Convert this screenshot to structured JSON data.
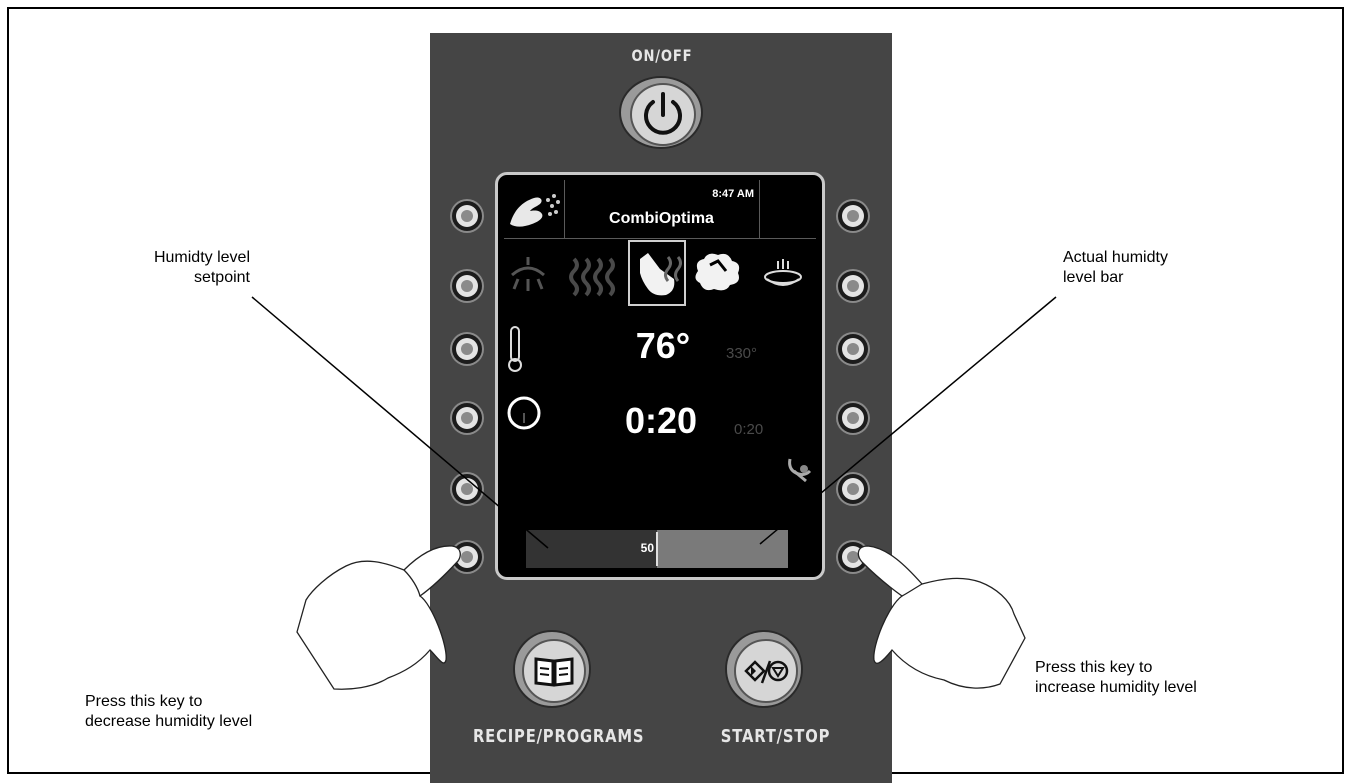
{
  "panel": {
    "on_off_label": "ON/OFF",
    "recipe_label": "RECIPE/PROGRAMS",
    "start_stop_label": "START/STOP"
  },
  "screen": {
    "time": "8:47 AM",
    "title": "CombiOptima",
    "temperature_actual": "76°",
    "temperature_set": "330°",
    "timer_actual": "0:20",
    "timer_set": "0:20",
    "humidity_setpoint": "50",
    "humidity_level": 0.5
  },
  "callouts": {
    "setpoint_line1": "Humidty level",
    "setpoint_line2": "setpoint",
    "bar_line1": "Actual humidty",
    "bar_line2": "level bar",
    "decrease_line1": "Press this key to",
    "decrease_line2": "decrease humidity level",
    "increase_line1": "Press this key to",
    "increase_line2": "increase humidity level"
  },
  "icons": [
    "power-icon",
    "hand-spray-icon",
    "shower-icon",
    "steam-waves-icon",
    "convection-fan-icon",
    "combi-steam-icon",
    "bowl-icon",
    "thermometer-icon",
    "clock-icon",
    "probe-icon",
    "recipe-book-icon",
    "start-stop-icon",
    "pointing-hand-icon"
  ]
}
